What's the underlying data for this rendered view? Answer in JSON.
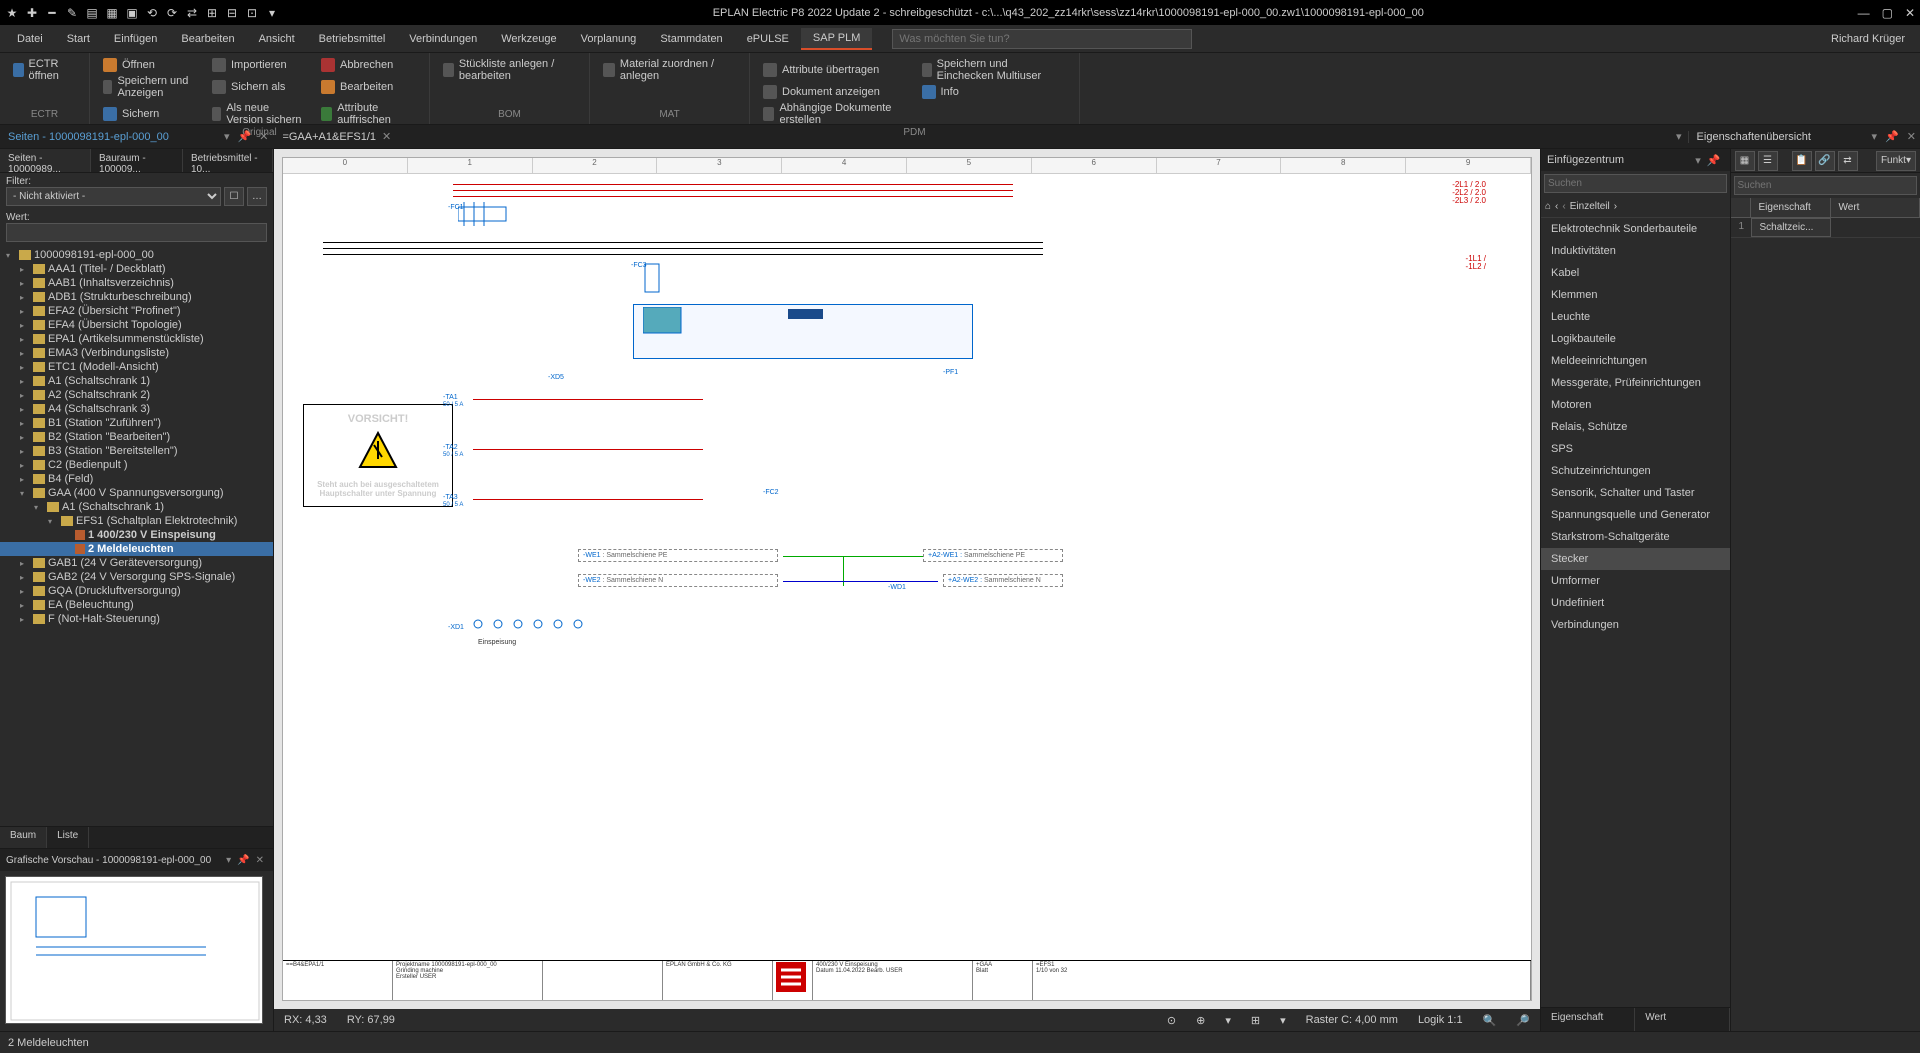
{
  "titlebar": {
    "title": "EPLAN Electric P8 2022 Update 2 - schreibgeschützt - c:\\...\\q43_202_zz14rkr\\sess\\zz14rkr\\1000098191-epl-000_00.zw1\\1000098191-epl-000_00"
  },
  "menubar": {
    "items": [
      "Datei",
      "Start",
      "Einfügen",
      "Bearbeiten",
      "Ansicht",
      "Betriebsmittel",
      "Verbindungen",
      "Werkzeuge",
      "Vorplanung",
      "Stammdaten",
      "ePULSE",
      "SAP PLM"
    ],
    "active_index": 11,
    "search_placeholder": "Was möchten Sie tun?",
    "user": "Richard Krüger"
  },
  "ribbon": {
    "groups": [
      {
        "label": "ECTR",
        "buttons": [
          "ECTR öffnen"
        ]
      },
      {
        "label": "Original",
        "buttons": [
          "Öffnen",
          "Speichern und Anzeigen",
          "Sichern",
          "Importieren",
          "Sichern als",
          "Als neue Version sichern",
          "Abbrechen",
          "Bearbeiten",
          "Attribute auffrischen"
        ]
      },
      {
        "label": "BOM",
        "buttons": [
          "Stückliste anlegen / bearbeiten"
        ]
      },
      {
        "label": "MAT",
        "buttons": [
          "Material zuordnen / anlegen"
        ]
      },
      {
        "label": "PDM",
        "buttons": [
          "Attribute übertragen",
          "Dokument anzeigen",
          "Abhängige Dokumente erstellen",
          "Speichern und Einchecken Multiuser",
          "Info"
        ]
      }
    ]
  },
  "doctabs": {
    "panel_title": "Seiten - 1000098191-epl-000_00",
    "tab_name": "=GAA+A1&EFS1/1"
  },
  "left_panel": {
    "tabs": [
      "Seiten - 10000989...",
      "Bauraum - 100009...",
      "Betriebsmittel - 10..."
    ],
    "filter_label": "Filter:",
    "filter_value": "- Nicht aktiviert -",
    "wert_label": "Wert:",
    "wert_value": "",
    "bottom_tabs": [
      "Baum",
      "Liste"
    ],
    "tree": [
      {
        "indent": 0,
        "expander": "▾",
        "icon": "folder",
        "label": "1000098191-epl-000_00"
      },
      {
        "indent": 1,
        "expander": "▸",
        "icon": "folder",
        "label": "AAA1 (Titel- / Deckblatt)"
      },
      {
        "indent": 1,
        "expander": "▸",
        "icon": "folder",
        "label": "AAB1 (Inhaltsverzeichnis)"
      },
      {
        "indent": 1,
        "expander": "▸",
        "icon": "folder",
        "label": "ADB1 (Strukturbeschreibung)"
      },
      {
        "indent": 1,
        "expander": "▸",
        "icon": "folder",
        "label": "EFA2 (Übersicht \"Profinet\")"
      },
      {
        "indent": 1,
        "expander": "▸",
        "icon": "folder",
        "label": "EFA4 (Übersicht Topologie)"
      },
      {
        "indent": 1,
        "expander": "▸",
        "icon": "folder",
        "label": "EPA1 (Artikelsummenstückliste)"
      },
      {
        "indent": 1,
        "expander": "▸",
        "icon": "folder",
        "label": "EMA3 (Verbindungsliste)"
      },
      {
        "indent": 1,
        "expander": "▸",
        "icon": "folder",
        "label": "ETC1 (Modell-Ansicht)"
      },
      {
        "indent": 1,
        "expander": "▸",
        "icon": "folder",
        "label": "A1 (Schaltschrank 1)"
      },
      {
        "indent": 1,
        "expander": "▸",
        "icon": "folder",
        "label": "A2 (Schaltschrank 2)"
      },
      {
        "indent": 1,
        "expander": "▸",
        "icon": "folder",
        "label": "A4 (Schaltschrank 3)"
      },
      {
        "indent": 1,
        "expander": "▸",
        "icon": "folder",
        "label": "B1 (Station \"Zuführen\")"
      },
      {
        "indent": 1,
        "expander": "▸",
        "icon": "folder",
        "label": "B2 (Station \"Bearbeiten\")"
      },
      {
        "indent": 1,
        "expander": "▸",
        "icon": "folder",
        "label": "B3 (Station \"Bereitstellen\")"
      },
      {
        "indent": 1,
        "expander": "▸",
        "icon": "folder",
        "label": "C2 (Bedienpult )"
      },
      {
        "indent": 1,
        "expander": "▸",
        "icon": "folder",
        "label": "B4 (Feld)"
      },
      {
        "indent": 1,
        "expander": "▾",
        "icon": "folder",
        "label": "GAA (400 V Spannungsversorgung)"
      },
      {
        "indent": 2,
        "expander": "▾",
        "icon": "folder",
        "label": "A1 (Schaltschrank 1)"
      },
      {
        "indent": 3,
        "expander": "▾",
        "icon": "folder",
        "label": "EFS1 (Schaltplan Elektrotechnik)"
      },
      {
        "indent": 4,
        "expander": "",
        "icon": "page",
        "label": "1 400/230 V Einspeisung",
        "bold": true
      },
      {
        "indent": 4,
        "expander": "",
        "icon": "page",
        "label": "2 Meldeleuchten",
        "selected": true,
        "bold": true
      },
      {
        "indent": 1,
        "expander": "▸",
        "icon": "folder",
        "label": "GAB1 (24 V Geräteversorgung)"
      },
      {
        "indent": 1,
        "expander": "▸",
        "icon": "folder",
        "label": "GAB2 (24 V Versorgung SPS-Signale)"
      },
      {
        "indent": 1,
        "expander": "▸",
        "icon": "folder",
        "label": "GQA (Druckluftversorgung)"
      },
      {
        "indent": 1,
        "expander": "▸",
        "icon": "folder",
        "label": "EA (Beleuchtung)"
      },
      {
        "indent": 1,
        "expander": "▸",
        "icon": "folder",
        "label": "F (Not-Halt-Steuerung)"
      }
    ]
  },
  "preview": {
    "title": "Grafische Vorschau - 1000098191-epl-000_00"
  },
  "schematic": {
    "ruler": [
      "0",
      "1",
      "2",
      "3",
      "4",
      "5",
      "6",
      "7",
      "8",
      "9"
    ],
    "phase_labels": [
      "-2L1 / 2.0",
      "-2L2 / 2.0",
      "-2L3 / 2.0"
    ],
    "neutral_labels": [
      "-1L1 /",
      "-1L2 /"
    ],
    "components": {
      "fc1": "-FC1",
      "fc2": "-FC2",
      "fc3": "-FC3",
      "xd5": "-XD5",
      "ta1": "-TA1",
      "ta1_rating": "50 / 5 A",
      "ta2": "-TA2",
      "ta2_rating": "50 / 5 A",
      "ta3": "-TA3",
      "ta3_rating": "50 / 5 A",
      "pf1": "-PF1",
      "xd1": "-XD1",
      "wd1": "-WD1",
      "we1": "-WE1",
      "we2": "-WE2",
      "we1_label": "Sammelschiene PE",
      "we2_label": "Sammelschiene N",
      "a2we1": "+A2-WE1 :",
      "a2we2": "+A2-WE2 :",
      "einspeisung": "Einspeisung"
    },
    "caution": {
      "title": "VORSICHT!",
      "text": "Steht auch bei ausgeschaltetem Hauptschalter unter Spannung"
    },
    "titleblock": {
      "ref": "==B4&EPA1/1",
      "projektname": "1000098191-epl-000_00",
      "beschreibung": "Grinding machine",
      "firma": "EPLAN GmbH & Co. KG",
      "seitentitel": "400/230 V Einspeisung",
      "ort": "+GAA",
      "blatt": "=EFS1",
      "ersteller": "Ersteller",
      "user": "USER",
      "datum": "11.04.2022",
      "seite": "1/10   von   32"
    },
    "status": {
      "rx": "RX: 4,33",
      "ry": "RY: 67,99",
      "raster": "Raster C: 4,00 mm",
      "logik": "Logik 1:1"
    }
  },
  "insert_center": {
    "title": "Einfügezentrum",
    "search_placeholder": "Suchen",
    "breadcrumb": "Einzelteil",
    "categories": [
      "Elektrotechnik Sonderbauteile",
      "Induktivitäten",
      "Kabel",
      "Klemmen",
      "Leuchte",
      "Logikbauteile",
      "Meldeeinrichtungen",
      "Messgeräte, Prüfeinrichtungen",
      "Motoren",
      "Relais, Schütze",
      "SPS",
      "Schutzeinrichtungen",
      "Sensorik, Schalter und Taster",
      "Spannungsquelle und Generator",
      "Starkstrom-Schaltgeräte",
      "Stecker",
      "Umformer",
      "Undefiniert",
      "Verbindungen"
    ],
    "selected_index": 15
  },
  "props_overview": {
    "title": "Eigenschaftenübersicht",
    "search_placeholder": "Suchen",
    "func_label": "Funkt",
    "cols": [
      "Eigenschaft",
      "Wert"
    ],
    "rows": [
      {
        "n": "1",
        "prop": "Schaltzeic...",
        "val": ""
      }
    ],
    "bottom": [
      "Eigenschaft",
      "Wert"
    ]
  },
  "statusbar": {
    "text": "2 Meldeleuchten"
  }
}
